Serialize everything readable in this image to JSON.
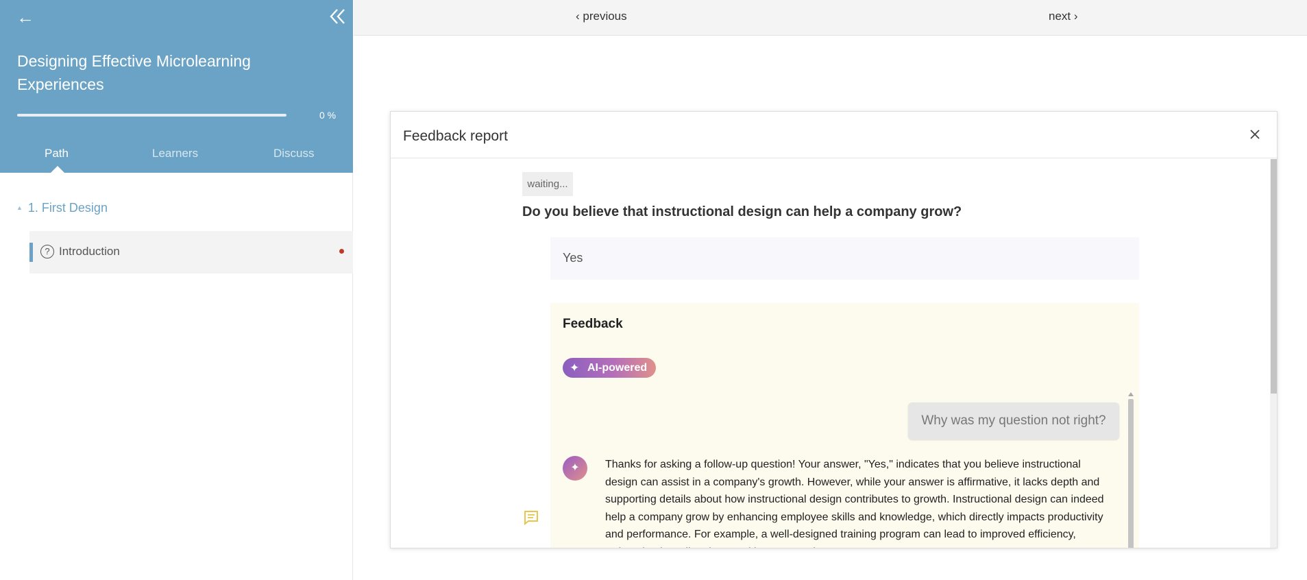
{
  "sidebar": {
    "back_icon": "left-arrow-icon",
    "collapse_icon": "double-chevron-left-icon",
    "course_title": "Designing Effective Microlearning Experiences",
    "progress": {
      "value": 0,
      "label": "0 %"
    },
    "tabs": [
      {
        "label": "Path",
        "active": true
      },
      {
        "label": "Learners",
        "active": false
      },
      {
        "label": "Discuss",
        "active": false
      }
    ],
    "section": {
      "label": "1. First Design"
    },
    "lesson": {
      "label": "Introduction",
      "icon": "question-circle-icon",
      "status_color": "#c0392b"
    }
  },
  "topbar": {
    "previous_label": "‹ previous",
    "next_label": "next ›"
  },
  "modal": {
    "title": "Feedback report",
    "status": "waiting...",
    "question": "Do you believe that instructional design can help a company grow?",
    "answer": "Yes",
    "feedback": {
      "title": "Feedback",
      "badge": "AI-powered",
      "user_message": "Why was my question not right?",
      "ai_message": "Thanks for asking a follow-up question! Your answer, \"Yes,\" indicates that you believe instructional design can assist in a company's growth. However, while your answer is affirmative, it lacks depth and supporting details about how instructional design contributes to growth. Instructional design can indeed help a company grow by enhancing employee skills and knowledge, which directly impacts productivity and performance. For example, a well-designed training program can lead to improved efficiency, reduced onboarding time, and better retention."
    }
  },
  "colors": {
    "sidebar_header": "#6aa3c5",
    "accent": "#6aa3c5",
    "feedback_bg": "#fdfaee",
    "badge_gradient_start": "#8b5fbf",
    "badge_gradient_end": "#e0908a"
  }
}
